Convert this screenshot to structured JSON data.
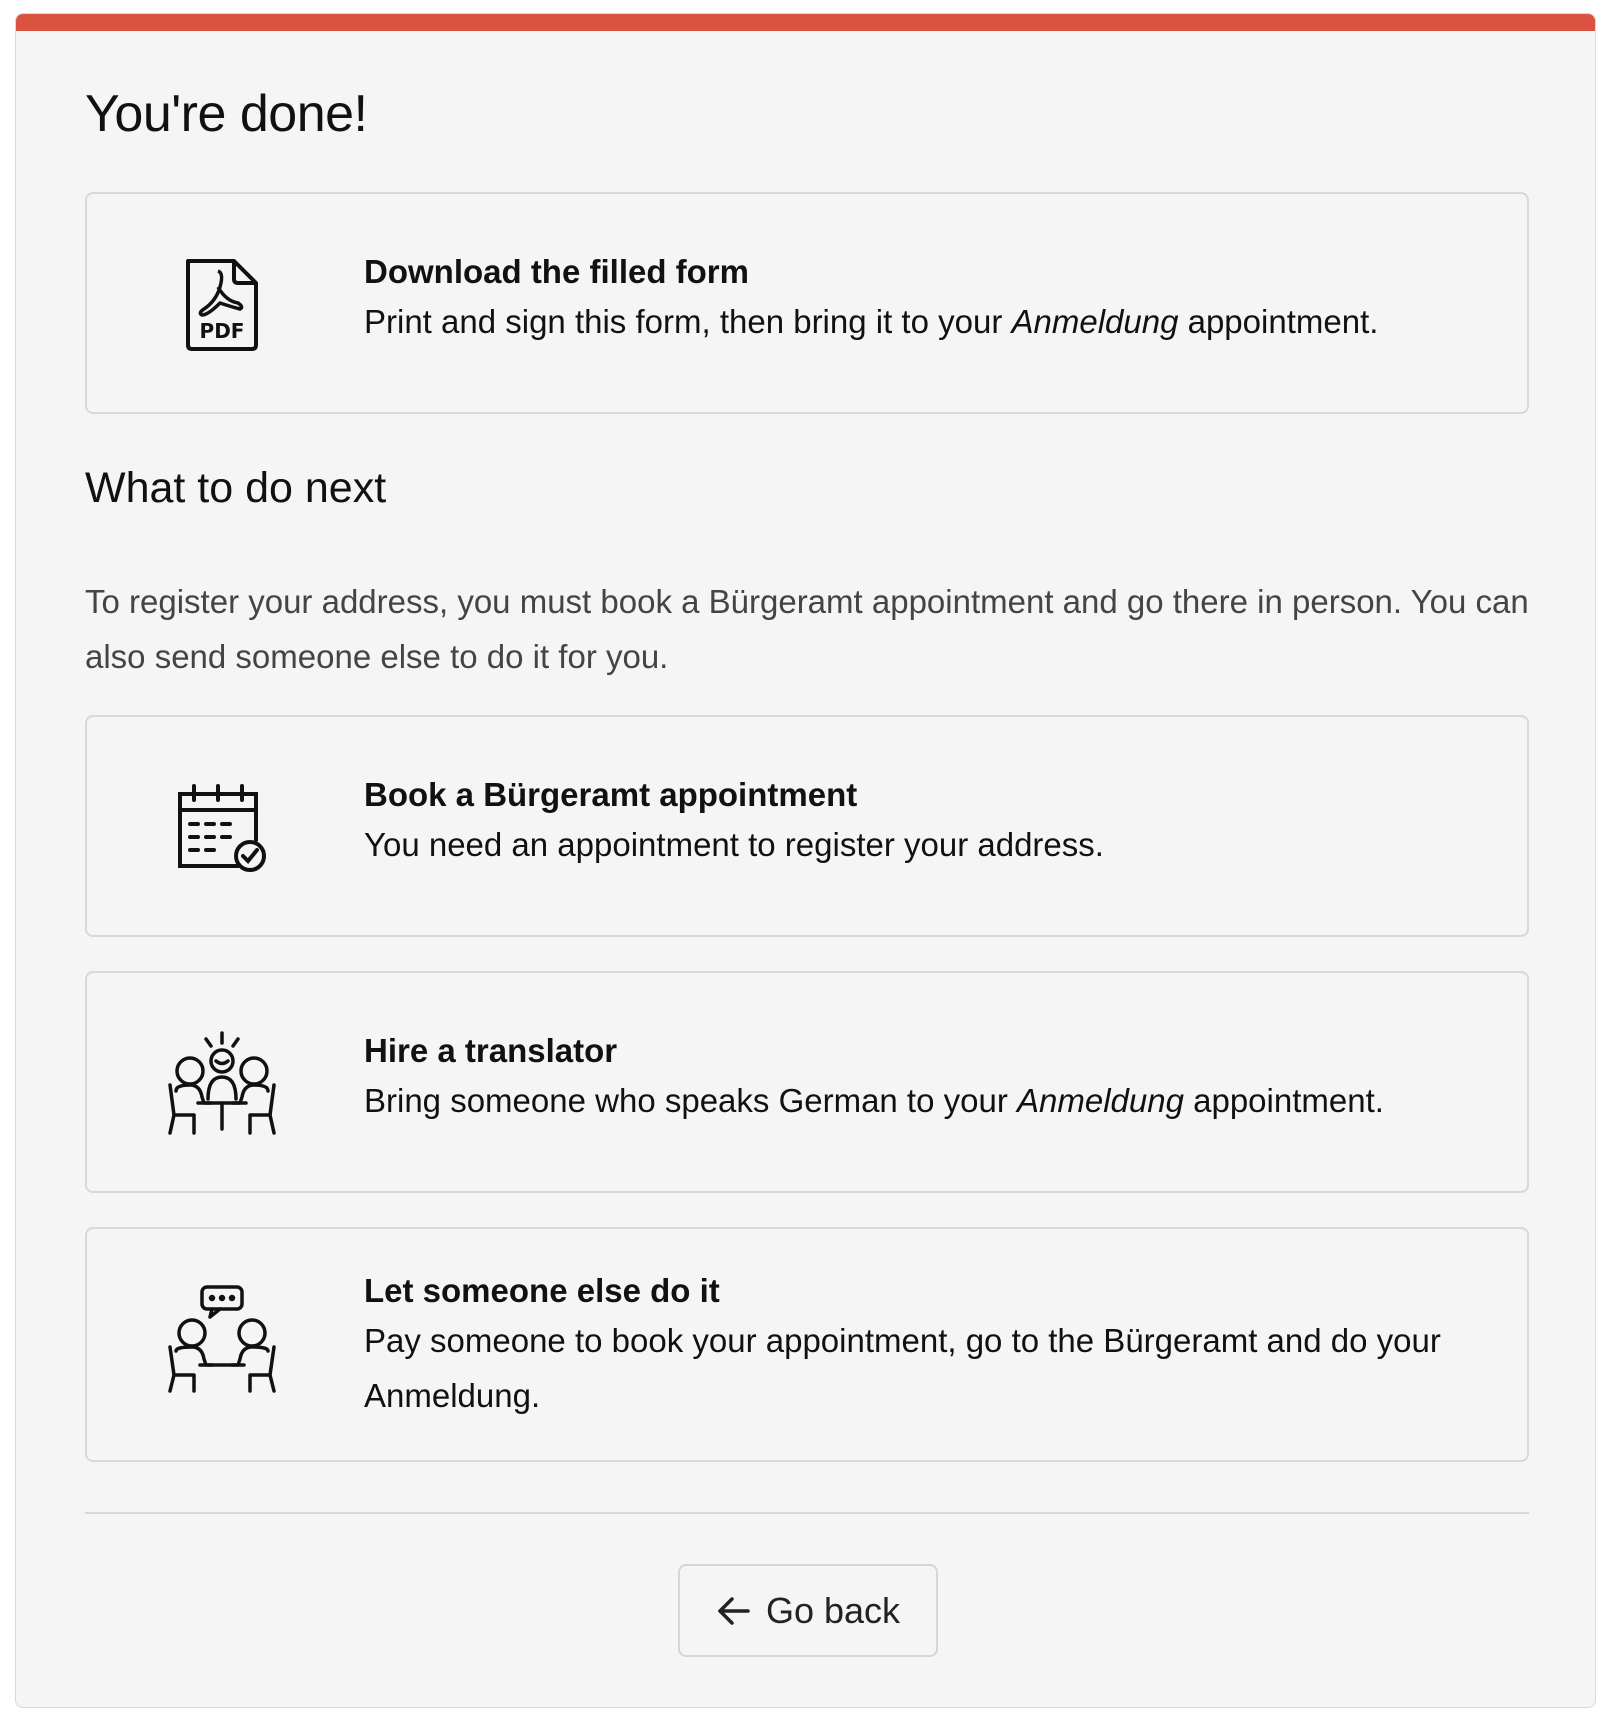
{
  "page": {
    "title": "You're done!",
    "accent_color": "#db5340"
  },
  "download_card": {
    "icon": "pdf-file-icon",
    "icon_text": "PDF",
    "title": "Download the filled form",
    "desc_before": "Print and sign this form, then bring it to your ",
    "desc_em": "Anmeldung",
    "desc_after": " appointment."
  },
  "next": {
    "title": "What to do next",
    "intro": "To register your address, you must book a Bürgeramt appointment and go there in person. You can also send someone else to do it for you."
  },
  "options": {
    "book": {
      "icon": "calendar-check-icon",
      "title": "Book a Bürgeramt appointment",
      "desc": "You need an appointment to register your address."
    },
    "translator": {
      "icon": "people-meeting-icon",
      "title": "Hire a translator",
      "desc_before": "Bring someone who speaks German to your ",
      "desc_em": "Anmeldung",
      "desc_after": " appointment."
    },
    "someone_else": {
      "icon": "people-chat-icon",
      "title": "Let someone else do it",
      "desc": "Pay someone to book your appointment, go to the Bürgeramt and do your Anmeldung."
    }
  },
  "footer": {
    "back_label": "Go back",
    "back_icon": "arrow-left-icon"
  }
}
